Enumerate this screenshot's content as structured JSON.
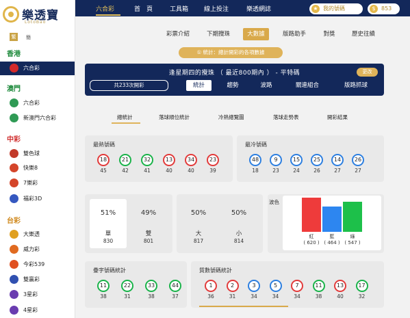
{
  "brand": {
    "name": "樂透寶",
    "sub": "LotoBao"
  },
  "topnav": {
    "items": [
      "六合彩",
      "首　頁",
      "工具箱",
      "線上投注",
      "樂透網誌"
    ],
    "my_number": "我的號碼",
    "coins": "853"
  },
  "sidebar": {
    "lang_trad": "繁",
    "lang_simp": "簡",
    "regions": [
      {
        "label": "香港",
        "color": "#1e8a3c"
      },
      {
        "label": "澳門",
        "color": "#1e8a3c"
      },
      {
        "label": "中彩",
        "color": "#d03030"
      },
      {
        "label": "台彩",
        "color": "#d08a20"
      }
    ],
    "items": [
      {
        "label": "六合彩",
        "icon": "hk-flag-icon",
        "color": "#d42a2a"
      },
      {
        "label": "六合彩",
        "icon": "macau-flag-icon",
        "color": "#2f9a55"
      },
      {
        "label": "新澳門六合彩",
        "icon": "macau-flag-icon",
        "color": "#2f9a55"
      },
      {
        "label": "雙色球",
        "icon": "lottery-icon",
        "color": "#c23a2a"
      },
      {
        "label": "快樂8",
        "icon": "lottery-icon",
        "color": "#d4452a"
      },
      {
        "label": "7樂彩",
        "icon": "lottery-icon",
        "color": "#d4452a"
      },
      {
        "label": "福彩3D",
        "icon": "lottery-icon",
        "color": "#3558c0"
      },
      {
        "label": "大樂透",
        "icon": "lottery-icon",
        "color": "#e0a020"
      },
      {
        "label": "威力彩",
        "icon": "lottery-icon",
        "color": "#e06a20"
      },
      {
        "label": "今彩539",
        "icon": "lottery-icon",
        "color": "#e05020"
      },
      {
        "label": "雙贏彩",
        "icon": "lottery-icon",
        "color": "#3050b0"
      },
      {
        "label": "3星彩",
        "icon": "lottery-icon",
        "color": "#6a3cb0"
      },
      {
        "label": "4星彩",
        "icon": "lottery-icon",
        "color": "#6a3cb0"
      }
    ]
  },
  "subtabs": [
    "彩票介紹",
    "下期攪珠",
    "大數據",
    "版路助手",
    "對獎",
    "歷史往績"
  ],
  "info": "① 統計：總計開彩的各項數據",
  "banner": {
    "title": "逢星期四的攪珠 （ 最近800期內 ） - 平特碼",
    "change": "更改",
    "period": "共233次開彩",
    "tabs": [
      "統計",
      "趨勢",
      "波路",
      "關連組合",
      "版路抓球"
    ]
  },
  "stat_tabs": [
    "總統計",
    "落球順位統計",
    "冷熱總覽圖",
    "落球走勢表",
    "開彩結果"
  ],
  "hot": {
    "title": "最熱號碼",
    "balls": [
      {
        "n": "18",
        "c": "red",
        "count": "45"
      },
      {
        "n": "21",
        "c": "green",
        "count": "42"
      },
      {
        "n": "32",
        "c": "green",
        "count": "41"
      },
      {
        "n": "13",
        "c": "red",
        "count": "40"
      },
      {
        "n": "34",
        "c": "red",
        "count": "40"
      },
      {
        "n": "23",
        "c": "red",
        "count": "39"
      }
    ]
  },
  "cold": {
    "title": "最冷號碼",
    "balls": [
      {
        "n": "48",
        "c": "blue",
        "count": "18"
      },
      {
        "n": "9",
        "c": "blue",
        "count": "23"
      },
      {
        "n": "15",
        "c": "blue",
        "count": "24"
      },
      {
        "n": "25",
        "c": "blue",
        "count": "26"
      },
      {
        "n": "14",
        "c": "blue",
        "count": "27"
      },
      {
        "n": "26",
        "c": "blue",
        "count": "27"
      }
    ]
  },
  "oddeven": {
    "odd_pct": "51%",
    "odd_label": "單",
    "odd_count": "830",
    "even_pct": "49%",
    "even_label": "雙",
    "even_count": "801"
  },
  "bigsmall": {
    "big_pct": "50%",
    "big_label": "大",
    "big_count": "817",
    "small_pct": "50%",
    "small_label": "小",
    "small_count": "814"
  },
  "color_label": "波色",
  "chart_data": {
    "type": "bar",
    "categories": [
      "紅",
      "藍",
      "綠"
    ],
    "values": [
      620,
      464,
      547
    ],
    "colors": [
      "#ee3b3b",
      "#2d86f0",
      "#1dc04a"
    ],
    "ylim": [
      0,
      660
    ]
  },
  "stack": {
    "title": "疊字號碼統計",
    "balls": [
      {
        "n": "11",
        "c": "green",
        "count": "38"
      },
      {
        "n": "22",
        "c": "green",
        "count": "31"
      },
      {
        "n": "33",
        "c": "green",
        "count": "38"
      },
      {
        "n": "44",
        "c": "green",
        "count": "37"
      }
    ]
  },
  "prime": {
    "title": "質數號碼統計",
    "balls": [
      {
        "n": "1",
        "c": "red",
        "count": "36"
      },
      {
        "n": "2",
        "c": "red",
        "count": "31"
      },
      {
        "n": "3",
        "c": "blue",
        "count": "34"
      },
      {
        "n": "5",
        "c": "blue",
        "count": "34"
      },
      {
        "n": "7",
        "c": "red",
        "count": "34"
      },
      {
        "n": "11",
        "c": "green",
        "count": "38"
      },
      {
        "n": "13",
        "c": "red",
        "count": "40"
      },
      {
        "n": "17",
        "c": "green",
        "count": "32"
      }
    ]
  }
}
